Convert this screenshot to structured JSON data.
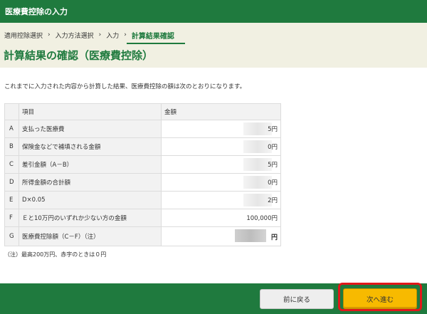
{
  "header": {
    "title": "医療費控除の入力"
  },
  "breadcrumb": {
    "steps": [
      "適用控除選択",
      "入力方法選択",
      "入力"
    ],
    "separator": "›",
    "current": "計算結果確認"
  },
  "page_title": "計算結果の確認（医療費控除）",
  "intro_text": "これまでに入力された内容から計算した結果、医療費控除の額は次のとおりになります。",
  "table": {
    "headers": {
      "key": "",
      "item": "項目",
      "amount": "金額"
    },
    "rows": [
      {
        "key": "A",
        "label": "支払った医療費",
        "amount": "5円"
      },
      {
        "key": "B",
        "label": "保険金などで補填される金額",
        "amount": "0円"
      },
      {
        "key": "C",
        "label": "差引金額（A－B）",
        "amount": "5円"
      },
      {
        "key": "D",
        "label": "所得金額の合計額",
        "amount": "0円"
      },
      {
        "key": "E",
        "label": "D×0.05",
        "amount": "2円"
      },
      {
        "key": "F",
        "label": "Ｅと10万円のいずれか少ない方の金額",
        "amount": "100,000円"
      },
      {
        "key": "G",
        "label": "医療費控除額（C－F）（注）",
        "amount": "円"
      }
    ]
  },
  "note": "（注）最高200万円、赤字のときは０円",
  "buttons": {
    "back": "前に戻る",
    "next": "次へ進む"
  },
  "colors": {
    "brand_green": "#1f7a3e",
    "accent_yellow": "#f7ba00",
    "highlight_red": "#e0181b"
  }
}
